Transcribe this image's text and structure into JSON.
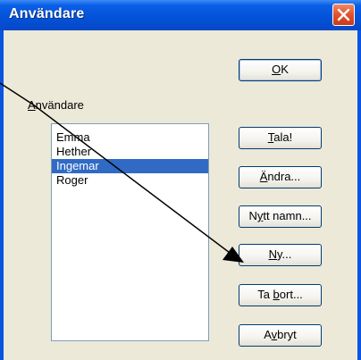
{
  "window": {
    "title": "Användare",
    "close_icon": "close-icon"
  },
  "list": {
    "label_prefix": "",
    "label_mnemonic": "A",
    "label_rest": "nvändare",
    "items": [
      {
        "name": "Emma",
        "selected": false
      },
      {
        "name": "Hether",
        "selected": false
      },
      {
        "name": "Ingemar",
        "selected": true
      },
      {
        "name": "Roger",
        "selected": false
      }
    ]
  },
  "buttons": {
    "ok": {
      "pre": "",
      "mn": "O",
      "post": "K"
    },
    "tala": {
      "pre": "",
      "mn": "T",
      "post": "ala!"
    },
    "andra": {
      "pre": "",
      "mn": "Ä",
      "post": "ndra..."
    },
    "nytt": {
      "pre": "N",
      "mn": "y",
      "post": "tt namn..."
    },
    "ny": {
      "pre": "",
      "mn": "N",
      "post": "y..."
    },
    "tabort": {
      "pre": "Ta ",
      "mn": "b",
      "post": "ort..."
    },
    "avbryt": {
      "pre": "A",
      "mn": "v",
      "post": "bryt"
    }
  },
  "colors": {
    "titlebar": "#0453d8",
    "dialog_bg": "#ece9d8",
    "selection": "#316ac5",
    "close_button": "#e1512c"
  },
  "annotations": {
    "arrow_icon": "pointer-arrow-icon"
  }
}
